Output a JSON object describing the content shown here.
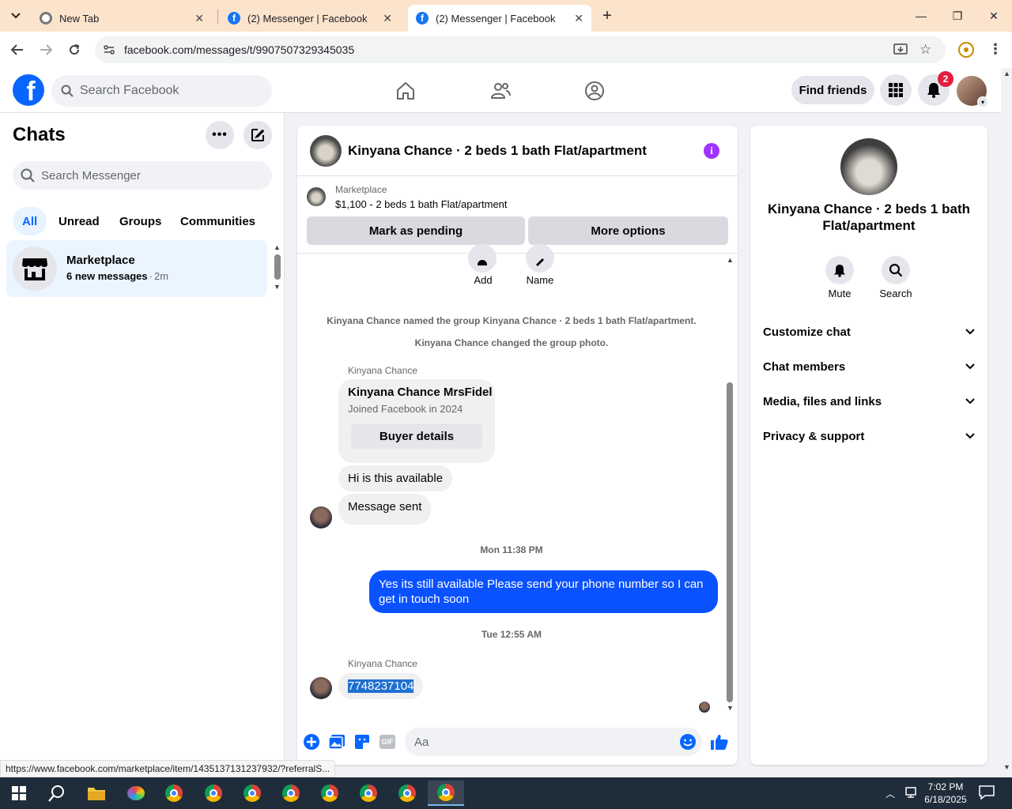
{
  "browser": {
    "tabs": [
      {
        "title": "New Tab"
      },
      {
        "title": "(2) Messenger | Facebook"
      },
      {
        "title": "(2) Messenger | Facebook"
      }
    ],
    "url": "facebook.com/messages/t/9907507329345035",
    "status_url": "https://www.facebook.com/marketplace/item/1435137131237932/?referralS..."
  },
  "fb_header": {
    "search_placeholder": "Search Facebook",
    "find_friends": "Find friends",
    "notif_count": "2"
  },
  "left": {
    "title": "Chats",
    "search_placeholder": "Search Messenger",
    "filters": [
      "All",
      "Unread",
      "Groups",
      "Communities"
    ],
    "chat": {
      "name": "Marketplace",
      "preview": "6 new messages",
      "time": "2m"
    }
  },
  "chat": {
    "title": "Kinyana Chance · 2 beds 1 bath Flat/apartment",
    "marketplace_label": "Marketplace",
    "listing": "$1,100 - 2 beds 1 bath Flat/apartment",
    "mark_pending": "Mark as pending",
    "more_options": "More options",
    "actions": {
      "add": "Add",
      "name": "Name"
    },
    "sys1": "Kinyana Chance named the group Kinyana Chance · 2 beds 1 bath Flat/apartment.",
    "sys2": "Kinyana Chance changed the group photo.",
    "sender": "Kinyana Chance",
    "card_name": "Kinyana Chance MrsFidel",
    "card_sub": "Joined Facebook in 2024",
    "buyer_details": "Buyer details",
    "msg1": "Hi is this available",
    "msg2": "Message sent",
    "time1": "Mon 11:38 PM",
    "out_msg": "Yes its still available Please send your phone number so I can get in touch soon",
    "time2": "Tue 12:55 AM",
    "sender2": "Kinyana Chance",
    "phone": "7748237104",
    "compose_placeholder": "Aa"
  },
  "right": {
    "name": "Kinyana Chance · 2 beds 1 bath Flat/apartment",
    "mute": "Mute",
    "search": "Search",
    "sections": [
      "Customize chat",
      "Chat members",
      "Media, files and links",
      "Privacy & support"
    ]
  },
  "taskbar": {
    "time": "7:02 PM",
    "date": "6/18/2025"
  },
  "colors": {
    "fb_blue": "#0866ff",
    "outgoing_bubble": "#0a52ff",
    "tab_bar": "#fbe3cc",
    "notif_red": "#e41e3f",
    "info_purple": "#a033ff"
  }
}
